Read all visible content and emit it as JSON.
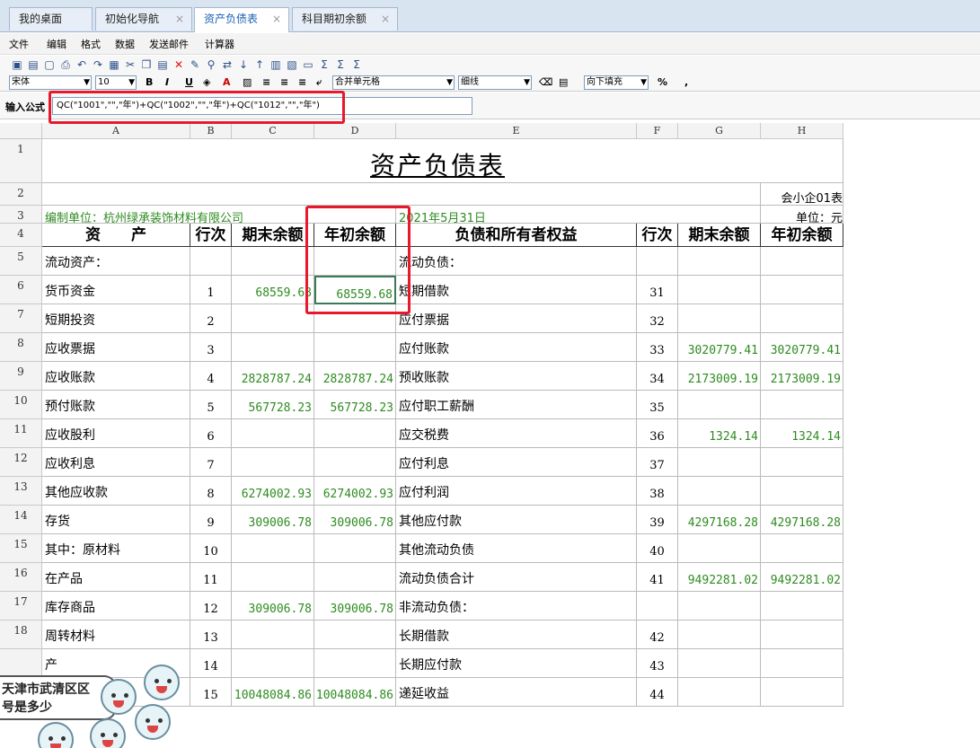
{
  "tabs": [
    {
      "label": "我的桌面",
      "closable": false
    },
    {
      "label": "初始化导航",
      "closable": true
    },
    {
      "label": "资产负债表",
      "closable": true,
      "active": true
    },
    {
      "label": "科目期初余额",
      "closable": true
    }
  ],
  "menu": [
    "文件",
    "编辑",
    "格式",
    "数据",
    "发送邮件",
    "计算器"
  ],
  "toolbar": {
    "font": "宋体",
    "size": "10",
    "merge": "合并单元格",
    "border": "细线",
    "fill": "向下填充",
    "percent": "%",
    "comma": ","
  },
  "formula": {
    "label": "输入公式",
    "value": "QC(\"1001\",\"\",\"年\")+QC(\"1002\",\"\",\"年\")+QC(\"1012\",\"\",\"年\")"
  },
  "columns": [
    "A",
    "B",
    "C",
    "D",
    "E",
    "F",
    "G",
    "H"
  ],
  "sheet": {
    "title": "资产负债表",
    "form_code": "会小企01表",
    "company": "编制单位：杭州绿承装饰材料有限公司",
    "date": "2021年5月31日",
    "unit": "单位：元",
    "headers": [
      "资　　产",
      "行次",
      "期末余额",
      "年初余额",
      "负债和所有者权益",
      "行次",
      "期末余额",
      "年初余额"
    ],
    "rows": [
      {
        "n": "5",
        "a": "流动资产：",
        "b": "",
        "c": "",
        "d": "",
        "e": "流动负债：",
        "f": "",
        "g": "",
        "h": ""
      },
      {
        "n": "6",
        "a": "货币资金",
        "b": "1",
        "c": "68559.68",
        "d": "68559.68",
        "e": "短期借款",
        "f": "31",
        "g": "",
        "h": ""
      },
      {
        "n": "7",
        "a": "短期投资",
        "b": "2",
        "c": "",
        "d": "",
        "e": "应付票据",
        "f": "32",
        "g": "",
        "h": ""
      },
      {
        "n": "8",
        "a": "应收票据",
        "b": "3",
        "c": "",
        "d": "",
        "e": "应付账款",
        "f": "33",
        "g": "3020779.41",
        "h": "3020779.41"
      },
      {
        "n": "9",
        "a": "应收账款",
        "b": "4",
        "c": "2828787.24",
        "d": "2828787.24",
        "e": "预收账款",
        "f": "34",
        "g": "2173009.19",
        "h": "2173009.19"
      },
      {
        "n": "10",
        "a": "预付账款",
        "b": "5",
        "c": "567728.23",
        "d": "567728.23",
        "e": "应付职工薪酬",
        "f": "35",
        "g": "",
        "h": ""
      },
      {
        "n": "11",
        "a": "应收股利",
        "b": "6",
        "c": "",
        "d": "",
        "e": "应交税费",
        "f": "36",
        "g": "1324.14",
        "h": "1324.14"
      },
      {
        "n": "12",
        "a": "应收利息",
        "b": "7",
        "c": "",
        "d": "",
        "e": "应付利息",
        "f": "37",
        "g": "",
        "h": ""
      },
      {
        "n": "13",
        "a": "其他应收款",
        "b": "8",
        "c": "6274002.93",
        "d": "6274002.93",
        "e": "应付利润",
        "f": "38",
        "g": "",
        "h": ""
      },
      {
        "n": "14",
        "a": "存货",
        "b": "9",
        "c": "309006.78",
        "d": "309006.78",
        "e": "其他应付款",
        "f": "39",
        "g": "4297168.28",
        "h": "4297168.28"
      },
      {
        "n": "15",
        "a": "其中：原材料",
        "b": "10",
        "c": "",
        "d": "",
        "e": "其他流动负债",
        "f": "40",
        "g": "",
        "h": ""
      },
      {
        "n": "16",
        "a": "在产品",
        "b": "11",
        "c": "",
        "d": "",
        "e": "流动负债合计",
        "f": "41",
        "g": "9492281.02",
        "h": "9492281.02"
      },
      {
        "n": "17",
        "a": "库存商品",
        "b": "12",
        "c": "309006.78",
        "d": "309006.78",
        "e": "非流动负债：",
        "f": "",
        "g": "",
        "h": ""
      },
      {
        "n": "18",
        "a": "周转材料",
        "b": "13",
        "c": "",
        "d": "",
        "e": "长期借款",
        "f": "42",
        "g": "",
        "h": ""
      },
      {
        "n": "",
        "a": "产",
        "b": "14",
        "c": "",
        "d": "",
        "e": "长期应付款",
        "f": "43",
        "g": "",
        "h": ""
      },
      {
        "n": "",
        "a": "",
        "b": "15",
        "c": "10048084.86",
        "d": "10048084.86",
        "e": "递延收益",
        "f": "44",
        "g": "",
        "h": ""
      }
    ]
  },
  "overlay": {
    "line1": "天津市武清区区",
    "line2": "号是多少"
  }
}
